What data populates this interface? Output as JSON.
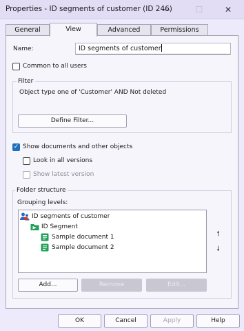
{
  "window": {
    "title": "Properties - ID segments of customer (ID 246)",
    "minimize_glyph": "—",
    "maximize_glyph": "☐",
    "close_glyph": "✕"
  },
  "tabs": [
    {
      "label": "General",
      "active": false
    },
    {
      "label": "View",
      "active": true
    },
    {
      "label": "Advanced",
      "active": false
    },
    {
      "label": "Permissions",
      "active": false
    }
  ],
  "name": {
    "label": "Name:",
    "value": "ID segments of customer"
  },
  "common_to_all_users": {
    "label": "Common to all users",
    "checked": false
  },
  "filter": {
    "legend": "Filter",
    "text": "Object type one of 'Customer' AND Not deleted",
    "define_button": "Define Filter..."
  },
  "show_documents": {
    "label": "Show documents and other objects",
    "checked": true
  },
  "look_in_all_versions": {
    "label": "Look in all versions",
    "checked": false
  },
  "show_latest_version": {
    "label": "Show latest version",
    "checked": false,
    "disabled": true
  },
  "folder_structure": {
    "legend": "Folder structure",
    "grouping_label": "Grouping levels:",
    "tree": [
      {
        "label": "ID segments of customer",
        "level": 0,
        "icon": "view-users-icon"
      },
      {
        "label": "ID Segment",
        "level": 1,
        "icon": "folder-green-icon"
      },
      {
        "label": "Sample document 1",
        "level": 2,
        "icon": "document-green-icon"
      },
      {
        "label": "Sample document 2",
        "level": 2,
        "icon": "document-green-icon"
      }
    ],
    "move_up_glyph": "🠕",
    "move_down_glyph": "🠗",
    "add_button": "Add...",
    "remove_button": "Remove",
    "edit_button": "Edit..."
  },
  "footer": {
    "ok": "OK",
    "cancel": "Cancel",
    "apply": "Apply",
    "help": "Help"
  },
  "colors": {
    "accent": "#1f6fbf",
    "green_icon": "#22a05a",
    "user_icon": "#2f68c0"
  }
}
